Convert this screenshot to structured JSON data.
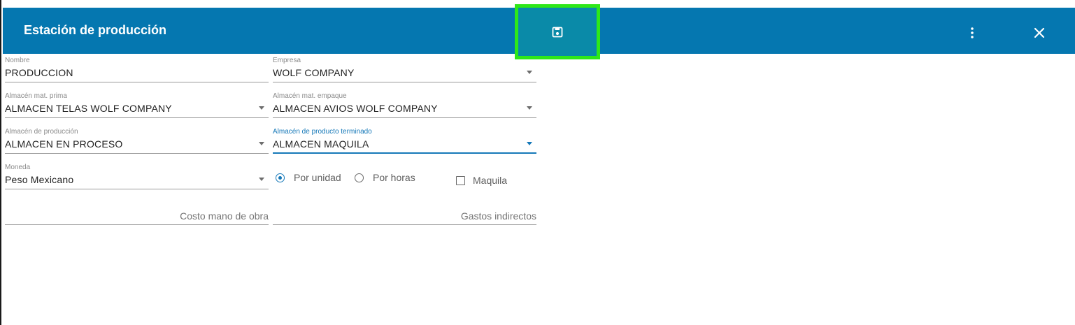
{
  "header": {
    "title": "Estación de producción",
    "colors": {
      "bar": "#0577b0",
      "save_highlight": "#2ee818",
      "active": "#1578b8"
    },
    "icons": {
      "save": "save-icon",
      "more": "more-vert-icon",
      "close": "close-icon"
    }
  },
  "form": {
    "nombre": {
      "label": "Nombre",
      "value": "PRODUCCION"
    },
    "empresa": {
      "label": "Empresa",
      "value": "WOLF COMPANY"
    },
    "almacen_mat_prima": {
      "label": "Almacén mat. prima",
      "value": "ALMACEN TELAS WOLF COMPANY"
    },
    "almacen_mat_empaque": {
      "label": "Almacén mat. empaque",
      "value": "ALMACEN AVIOS WOLF COMPANY"
    },
    "almacen_produccion": {
      "label": "Almacén de producción",
      "value": "ALMACEN EN PROCESO"
    },
    "almacen_terminado": {
      "label": "Almacén de producto terminado",
      "value": "ALMACEN MAQUILA"
    },
    "moneda": {
      "label": "Moneda",
      "value": "Peso Mexicano"
    },
    "radios": [
      {
        "label": "Por unidad",
        "checked": true
      },
      {
        "label": "Por horas",
        "checked": false
      }
    ],
    "maquila": {
      "label": "Maquila",
      "checked": false
    },
    "costo_mano_obra": {
      "placeholder": "Costo mano de obra",
      "value": ""
    },
    "gastos_indirectos": {
      "placeholder": "Gastos indirectos",
      "value": ""
    }
  }
}
